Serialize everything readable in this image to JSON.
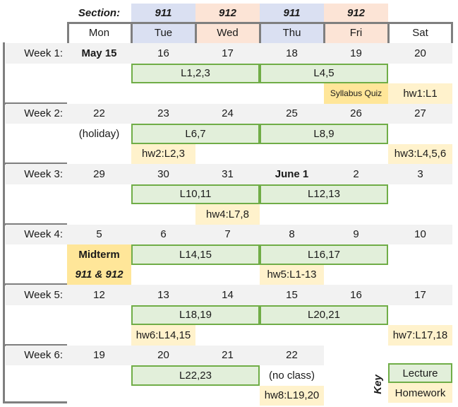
{
  "section_row": {
    "label": "Section:",
    "sections": [
      "911",
      "912",
      "911",
      "912"
    ]
  },
  "days": [
    "Mon",
    "Tue",
    "Wed",
    "Thu",
    "Fri",
    "Sat"
  ],
  "weeks": [
    {
      "label": "Week 1:",
      "dates": [
        "May 15",
        "16",
        "17",
        "18",
        "19",
        "20"
      ],
      "lectures": [
        "L1,2,3",
        "L4,5"
      ],
      "mon_note": "",
      "homework": [
        {
          "day": "Sat",
          "text": "hw1:L1"
        }
      ],
      "quiz": "Syllabus Quiz"
    },
    {
      "label": "Week 2:",
      "dates": [
        "22",
        "23",
        "24",
        "25",
        "26",
        "27"
      ],
      "lectures": [
        "L6,7",
        "L8,9"
      ],
      "mon_note": "(holiday)",
      "homework": [
        {
          "day": "Tue",
          "text": "hw2:L2,3"
        },
        {
          "day": "Sat",
          "text": "hw3:L4,5,6"
        }
      ]
    },
    {
      "label": "Week 3:",
      "dates": [
        "29",
        "30",
        "31",
        "June 1",
        "2",
        "3"
      ],
      "lectures": [
        "L10,11",
        "L12,13"
      ],
      "mon_note": "",
      "homework": [
        {
          "day": "Wed",
          "text": "hw4:L7,8"
        }
      ]
    },
    {
      "label": "Week 4:",
      "dates": [
        "5",
        "6",
        "7",
        "8",
        "9",
        "10"
      ],
      "lectures": [
        "L14,15",
        "L16,17"
      ],
      "mon_note": "",
      "midterm": {
        "title": "Midterm",
        "sections": "911 & 912"
      },
      "homework": [
        {
          "day": "Thu",
          "text": "hw5:L1-13"
        }
      ]
    },
    {
      "label": "Week 5:",
      "dates": [
        "12",
        "13",
        "14",
        "15",
        "16",
        "17"
      ],
      "lectures": [
        "L18,19",
        "L20,21"
      ],
      "mon_note": "",
      "homework": [
        {
          "day": "Tue",
          "text": "hw6:L14,15"
        },
        {
          "day": "Sat",
          "text": "hw7:L17,18"
        }
      ]
    },
    {
      "label": "Week 6:",
      "dates": [
        "19",
        "20",
        "21",
        "22"
      ],
      "lectures": [
        "L22,23"
      ],
      "thu_note": "(no class)",
      "homework": [
        {
          "day": "Thu",
          "text": "hw8:L19,20"
        }
      ]
    }
  ],
  "key": {
    "title": "Key",
    "lecture": "Lecture",
    "homework": "Homework"
  },
  "colors": {
    "section_911": "#dae0f2",
    "section_912": "#fce4d6",
    "lecture_fill": "#e2efda",
    "lecture_border": "#70ad47",
    "homework_fill": "#fff2cc",
    "quiz_fill": "#ffe699",
    "date_row_fill": "#f2f2f2"
  }
}
